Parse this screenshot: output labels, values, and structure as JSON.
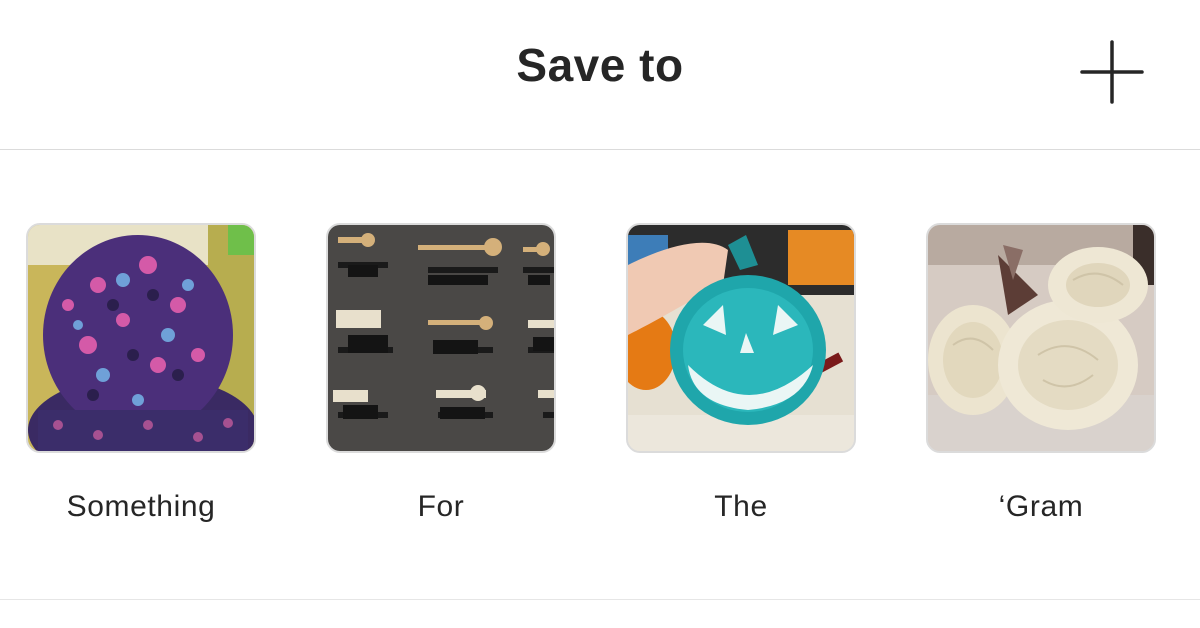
{
  "header": {
    "title": "Save to",
    "add_icon": "plus-icon"
  },
  "collections": [
    {
      "name": "Something",
      "thumbnail": "knit-pompom-hat"
    },
    {
      "name": "For",
      "thumbnail": "decorative-keys-wall"
    },
    {
      "name": "The",
      "thumbnail": "teal-pumpkin-bucket"
    },
    {
      "name": "‘Gram",
      "thumbnail": "white-roses"
    }
  ],
  "colors": {
    "text": "#262626",
    "divider": "#dbdbdb",
    "background": "#ffffff"
  }
}
